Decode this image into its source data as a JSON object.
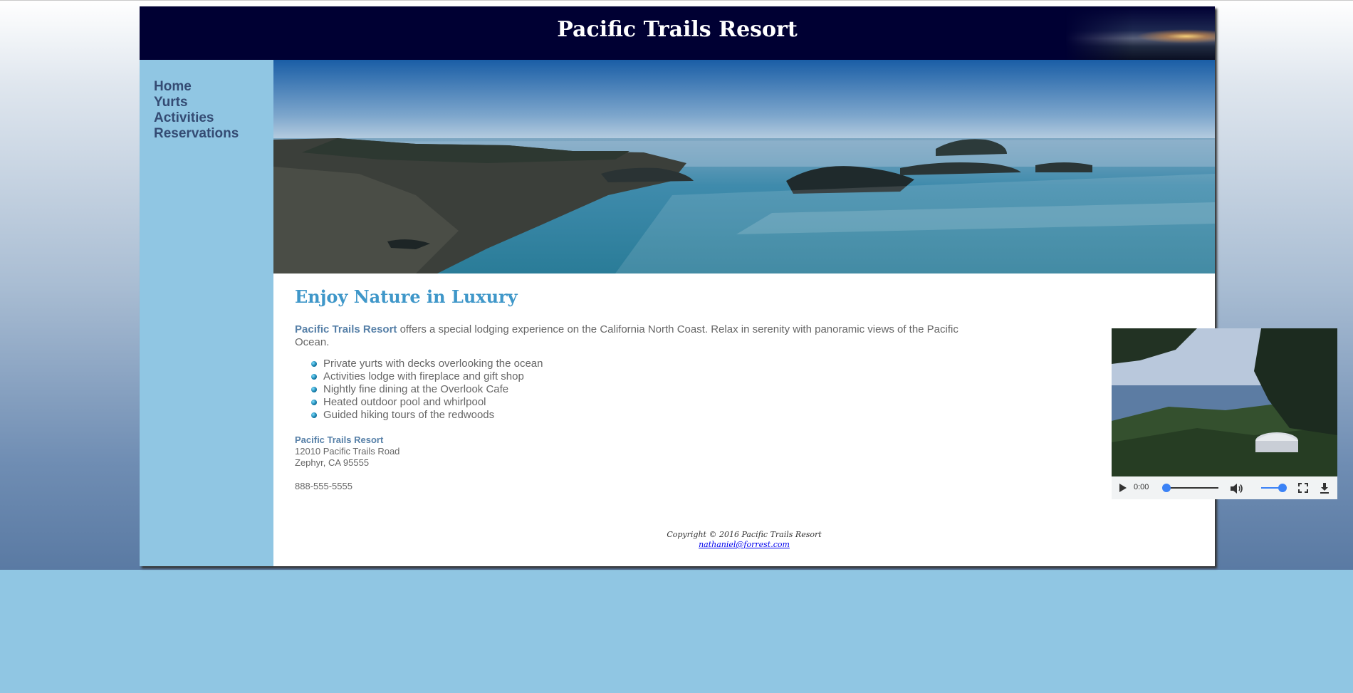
{
  "site": {
    "title": "Pacific Trails Resort"
  },
  "nav": {
    "items": [
      {
        "label": "Home"
      },
      {
        "label": "Yurts"
      },
      {
        "label": "Activities"
      },
      {
        "label": "Reservations"
      }
    ]
  },
  "main": {
    "heading": "Enjoy Nature in Luxury",
    "intro_brand": "Pacific Trails Resort",
    "intro_text": " offers a special lodging experience on the California North Coast. Relax in serenity with panoramic views of the Pacific Ocean.",
    "features": [
      "Private yurts with decks overlooking the ocean",
      "Activities lodge with fireplace and gift shop",
      "Nightly fine dining at the Overlook Cafe",
      "Heated outdoor pool and whirlpool",
      "Guided hiking tours of the redwoods"
    ],
    "contact": {
      "name": "Pacific Trails Resort",
      "street": "12010 Pacific Trails Road",
      "city": "Zephyr, CA 95555",
      "phone": "888-555-5555"
    }
  },
  "video": {
    "current_time": "0:00",
    "progress": 0,
    "volume": 1.0,
    "accent_color": "#3b82f6"
  },
  "footer": {
    "copyright": "Copyright © 2016 Pacific Trails Resort",
    "email": "nathaniel@forrest.com"
  },
  "colors": {
    "header_bg": "#000033",
    "nav_bg": "#90c6e3",
    "nav_link": "#344b73",
    "heading": "#3f97c9",
    "brand": "#5780a8",
    "text": "#666666"
  },
  "icons": [
    "play-icon",
    "volume-icon",
    "fullscreen-icon",
    "download-icon",
    "list-bullet-icon"
  ]
}
